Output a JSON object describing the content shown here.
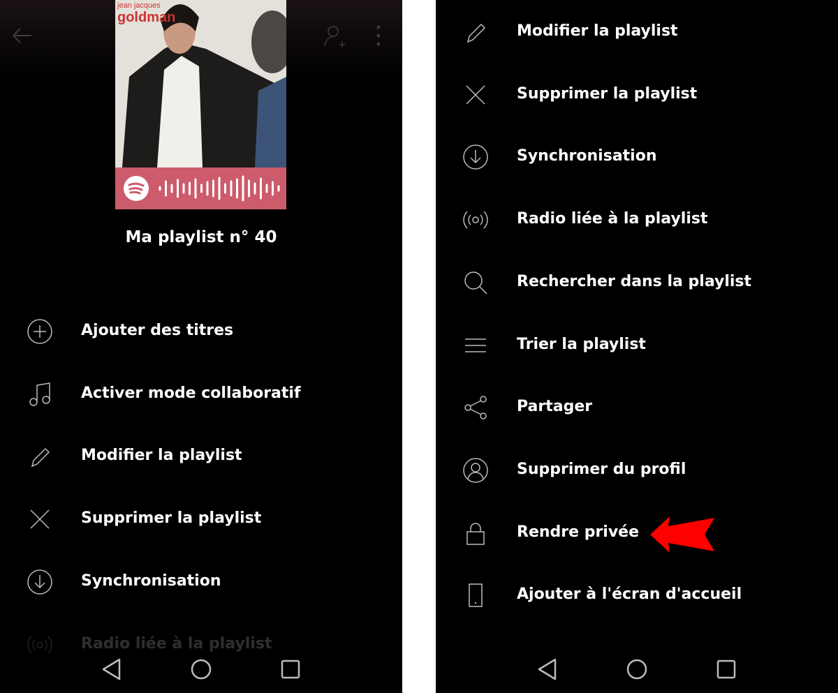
{
  "left": {
    "header": {
      "back_icon": "arrow-left-icon",
      "add_user_icon": "add-user-icon",
      "more_icon": "more-vertical-icon"
    },
    "cover": {
      "artist_text": "jean jacques",
      "artist_name": "goldman",
      "code_color": "#cc5b6b"
    },
    "playlist_title": "Ma playlist n° 40",
    "menu": [
      {
        "label": "Ajouter des titres",
        "icon": "plus-circle-icon"
      },
      {
        "label": "Activer mode collaboratif",
        "icon": "music-note-icon"
      },
      {
        "label": "Modifier la playlist",
        "icon": "pencil-icon"
      },
      {
        "label": "Supprimer la playlist",
        "icon": "x-icon"
      },
      {
        "label": "Synchronisation",
        "icon": "download-circle-icon"
      },
      {
        "label": "Radio liée à la playlist",
        "icon": "radio-icon"
      }
    ]
  },
  "right": {
    "menu": [
      {
        "label": "Modifier la playlist",
        "icon": "pencil-icon"
      },
      {
        "label": "Supprimer la playlist",
        "icon": "x-icon"
      },
      {
        "label": "Synchronisation",
        "icon": "download-circle-icon"
      },
      {
        "label": "Radio liée à la playlist",
        "icon": "radio-icon"
      },
      {
        "label": "Rechercher dans la playlist",
        "icon": "search-icon"
      },
      {
        "label": "Trier la playlist",
        "icon": "menu-lines-icon"
      },
      {
        "label": "Partager",
        "icon": "share-icon"
      },
      {
        "label": "Supprimer du profil",
        "icon": "user-circle-icon"
      },
      {
        "label": "Rendre privée",
        "icon": "lock-icon"
      },
      {
        "label": "Ajouter à l'écran d'accueil",
        "icon": "phone-icon"
      }
    ],
    "annotation_color": "#ff0000"
  },
  "navbar": {
    "back": "triangle-back-icon",
    "home": "circle-home-icon",
    "recents": "square-recents-icon"
  }
}
